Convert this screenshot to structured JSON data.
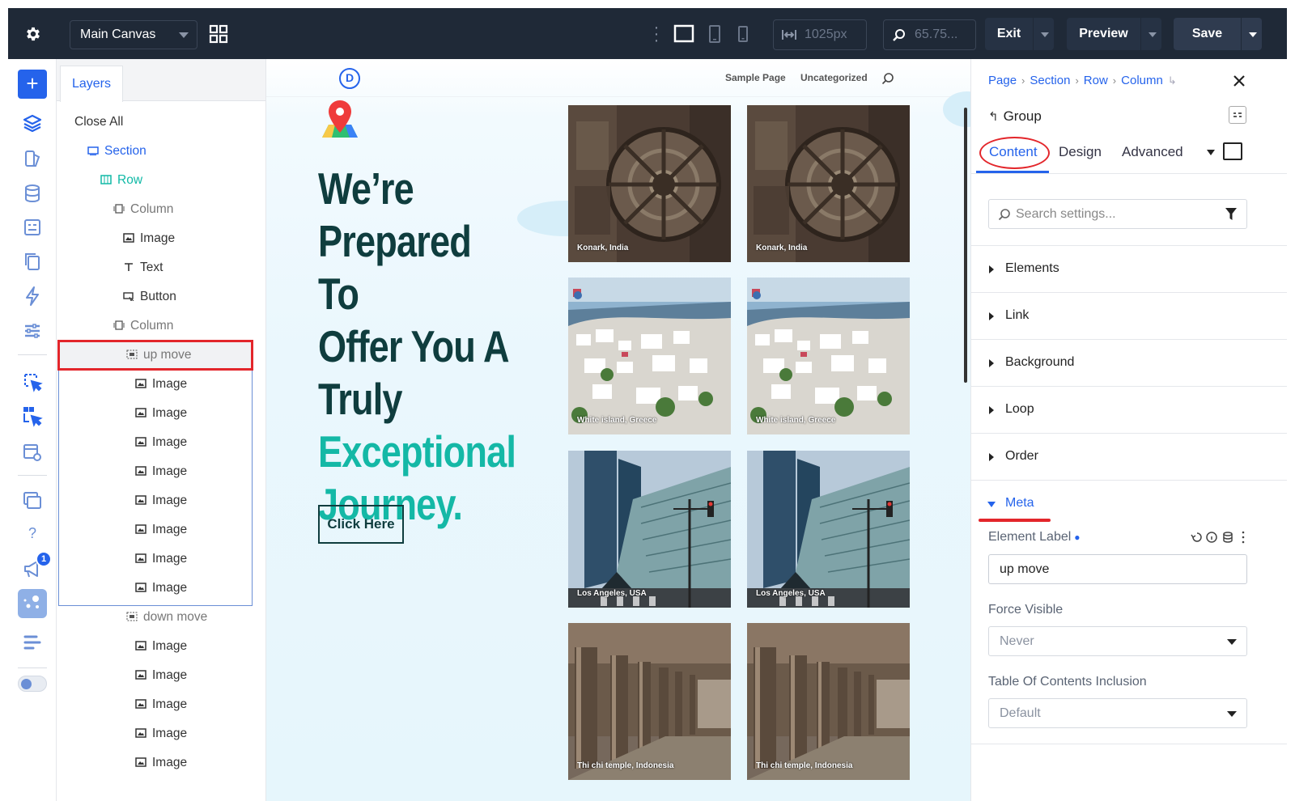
{
  "topbar": {
    "canvas_select": "Main Canvas",
    "width_value": "1025px",
    "zoom_value": "65.75...",
    "exit_label": "Exit",
    "preview_label": "Preview",
    "save_label": "Save"
  },
  "rail": {
    "notification_count": "1",
    "help_glyph": "?"
  },
  "layers": {
    "tab_label": "Layers",
    "close_all": "Close All",
    "items": [
      {
        "label": "Section",
        "type": "section"
      },
      {
        "label": "Row",
        "type": "row"
      },
      {
        "label": "Column",
        "type": "column"
      },
      {
        "label": "Image",
        "type": "image"
      },
      {
        "label": "Text",
        "type": "text"
      },
      {
        "label": "Button",
        "type": "button"
      },
      {
        "label": "Column",
        "type": "column"
      },
      {
        "label": "up move",
        "type": "group"
      },
      {
        "label": "Image",
        "type": "image"
      },
      {
        "label": "Image",
        "type": "image"
      },
      {
        "label": "Image",
        "type": "image"
      },
      {
        "label": "Image",
        "type": "image"
      },
      {
        "label": "Image",
        "type": "image"
      },
      {
        "label": "Image",
        "type": "image"
      },
      {
        "label": "Image",
        "type": "image"
      },
      {
        "label": "Image",
        "type": "image"
      },
      {
        "label": "down move",
        "type": "group"
      },
      {
        "label": "Image",
        "type": "image"
      },
      {
        "label": "Image",
        "type": "image"
      },
      {
        "label": "Image",
        "type": "image"
      },
      {
        "label": "Image",
        "type": "image"
      },
      {
        "label": "Image",
        "type": "image"
      }
    ]
  },
  "canvas": {
    "logo_letter": "D",
    "nav": [
      "Sample Page",
      "Uncategorized"
    ],
    "headline_dark": [
      "We’re",
      "Prepared To",
      "Offer You A",
      "Truly"
    ],
    "headline_teal": [
      "Exceptional",
      "Journey."
    ],
    "cta_label": "Click Here",
    "tiles": [
      {
        "caption": "Konark, India",
        "scene": "wheel"
      },
      {
        "caption": "Konark, India",
        "scene": "wheel"
      },
      {
        "caption": "White island, Greece",
        "scene": "village"
      },
      {
        "caption": "White island, Greece",
        "scene": "village"
      },
      {
        "caption": "Los Angeles, USA",
        "scene": "city"
      },
      {
        "caption": "Los Angeles, USA",
        "scene": "city"
      },
      {
        "caption": "Thi chi temple, Indonesia",
        "scene": "temple"
      },
      {
        "caption": "Thi chi temple, Indonesia",
        "scene": "temple"
      }
    ]
  },
  "settings": {
    "breadcrumbs": [
      "Page",
      "Section",
      "Row",
      "Column"
    ],
    "group_title": "Group",
    "tabs": [
      "Content",
      "Design",
      "Advanced"
    ],
    "search_placeholder": "Search settings...",
    "sections": [
      "Elements",
      "Link",
      "Background",
      "Loop",
      "Order"
    ],
    "meta_title": "Meta",
    "element_label_title": "Element Label",
    "element_label_value": "up move",
    "force_visible_title": "Force Visible",
    "force_visible_value": "Never",
    "toc_title": "Table Of Contents Inclusion",
    "toc_value": "Default"
  },
  "colors": {
    "accent": "#2563eb",
    "teal": "#14b8a6",
    "dark_teal": "#0f3d3e",
    "topbar": "#1f2937",
    "highlight": "#e3262b"
  }
}
